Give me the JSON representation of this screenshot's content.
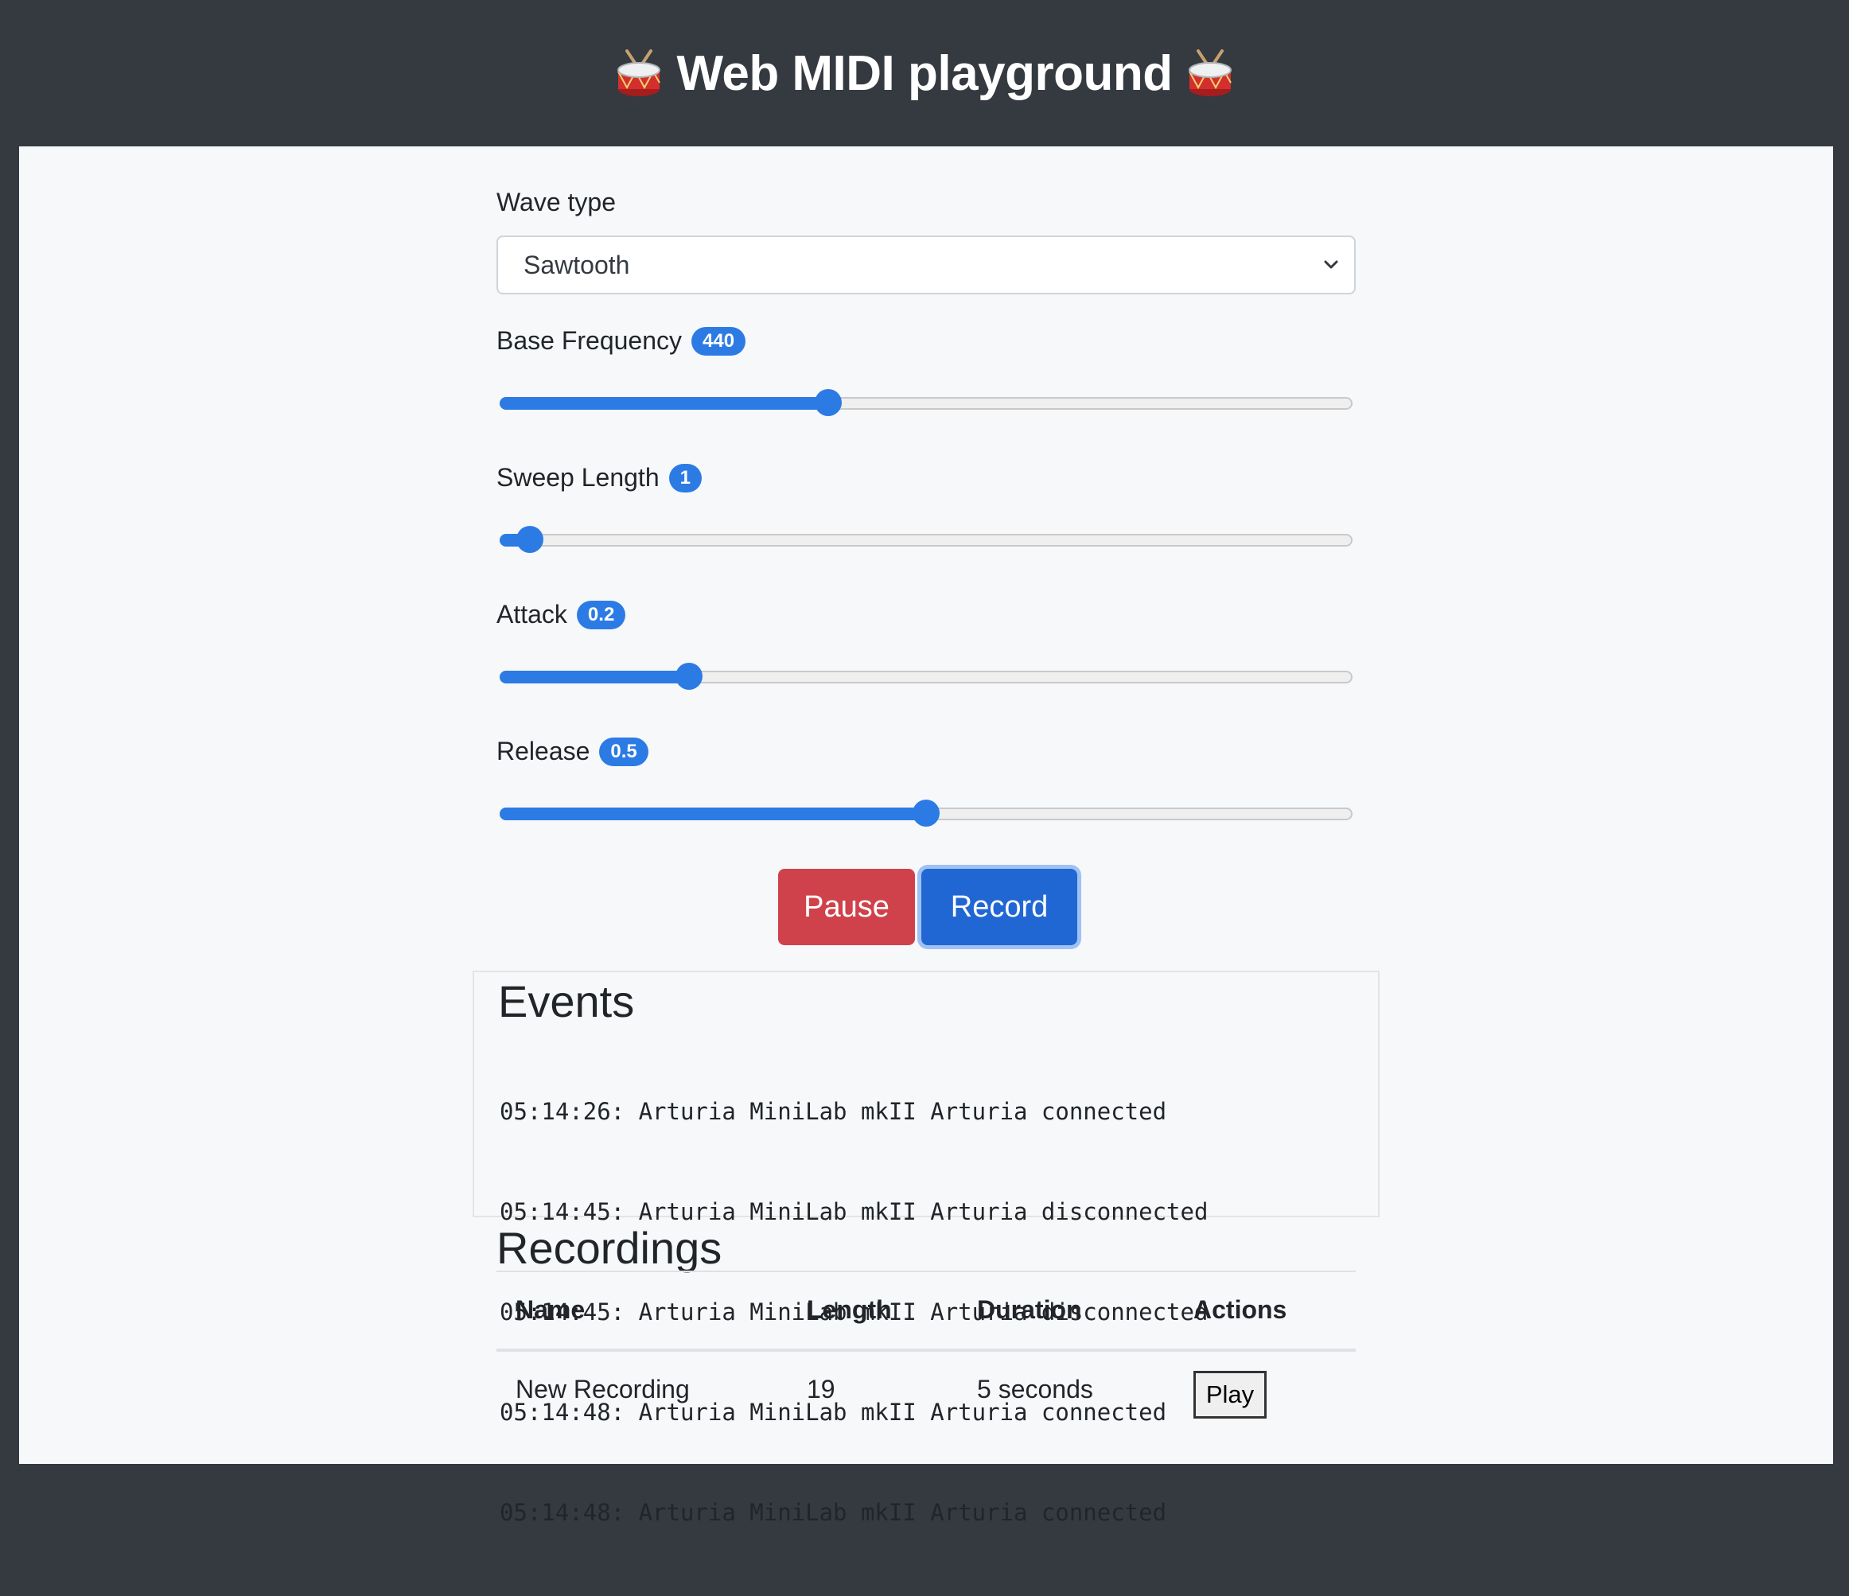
{
  "header": {
    "title": "Web MIDI playground",
    "left_icon": "drum-icon",
    "right_icon": "drum-icon"
  },
  "wave": {
    "label": "Wave type",
    "selected": "Sawtooth"
  },
  "sliders": [
    {
      "label": "Base Frequency",
      "value": "440",
      "fraction": 0.385
    },
    {
      "label": "Sweep Length",
      "value": "1",
      "fraction": 0.035
    },
    {
      "label": "Attack",
      "value": "0.2",
      "fraction": 0.222
    },
    {
      "label": "Release",
      "value": "0.5",
      "fraction": 0.5
    }
  ],
  "buttons": {
    "pause": "Pause",
    "record": "Record"
  },
  "events": {
    "title": "Events",
    "lines": [
      "05:14:26: Arturia MiniLab mkII Arturia connected",
      "05:14:45: Arturia MiniLab mkII Arturia disconnected",
      "05:14:45: Arturia MiniLab mkII Arturia disconnected",
      "05:14:48: Arturia MiniLab mkII Arturia connected",
      "05:14:48: Arturia MiniLab mkII Arturia connected"
    ]
  },
  "recordings": {
    "title": "Recordings",
    "columns": [
      "Name",
      "Length",
      "Duration",
      "Actions"
    ],
    "rows": [
      {
        "name": "New Recording",
        "length": "19",
        "duration": "5 seconds",
        "action": "Play"
      }
    ]
  },
  "colors": {
    "primary": "#2c7be5",
    "danger": "#d0424b",
    "header_bg": "#343a40"
  }
}
